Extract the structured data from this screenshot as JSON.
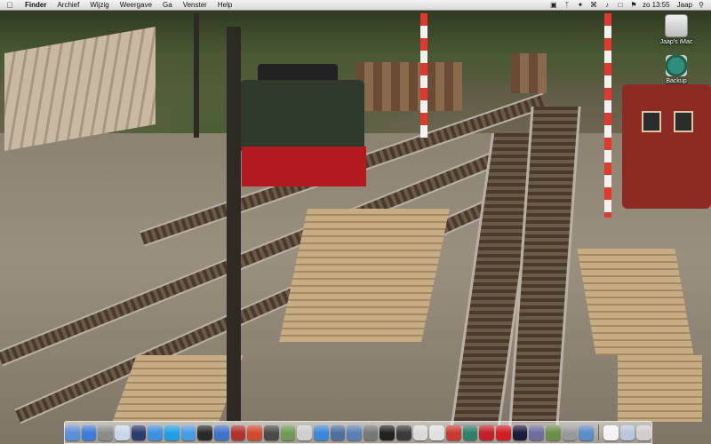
{
  "menubar": {
    "apple_icon": "apple-icon",
    "app_name": "Finder",
    "menus": [
      "Archief",
      "Wijzig",
      "Weergave",
      "Ga",
      "Venster",
      "Help"
    ],
    "tray_icons": [
      "airplay-icon",
      "bluetooth-icon",
      "twitter-icon",
      "wifi-icon",
      "volume-icon",
      "display-icon",
      "flag-icon"
    ],
    "clock": "zo 13:55",
    "user": "Jaap",
    "spotlight_icon": "spotlight-icon"
  },
  "desktop": {
    "icons": [
      {
        "label": "Jaap's iMac",
        "icon": "hard-drive-icon"
      },
      {
        "label": "Backup",
        "icon": "time-machine-icon"
      }
    ]
  },
  "dock": {
    "apps": [
      {
        "icon": "finder-icon",
        "color": "#5b8fd6"
      },
      {
        "icon": "safari-icon",
        "color": "#3f7bd8"
      },
      {
        "icon": "system-preferences-icon",
        "color": "#8c8c8c"
      },
      {
        "icon": "preview-icon",
        "color": "#c9d9ea"
      },
      {
        "icon": "dashboard-icon",
        "color": "#2b3b6c"
      },
      {
        "icon": "app-store-icon",
        "color": "#3d8fe0"
      },
      {
        "icon": "skype-icon",
        "color": "#1fa0e6"
      },
      {
        "icon": "messages-icon",
        "color": "#4a9be3"
      },
      {
        "icon": "spotify-icon",
        "color": "#2a2a2a"
      },
      {
        "icon": "itunes-icon",
        "color": "#3b74c9"
      },
      {
        "icon": "photo-booth-icon",
        "color": "#b0322c"
      },
      {
        "icon": "photo-icon",
        "color": "#d04a2f"
      },
      {
        "icon": "imovie-icon",
        "color": "#4a4a4a"
      },
      {
        "icon": "iphoto-icon",
        "color": "#6f9a56"
      },
      {
        "icon": "screenshot-icon",
        "color": "#cfcfcf"
      },
      {
        "icon": "iweb-icon",
        "color": "#3c87d8"
      },
      {
        "icon": "drive-icon",
        "color": "#4f6f9e"
      },
      {
        "icon": "network-icon",
        "color": "#5a80b2"
      },
      {
        "icon": "utility-icon",
        "color": "#777777"
      },
      {
        "icon": "terminal-icon",
        "color": "#222222"
      },
      {
        "icon": "activity-icon",
        "color": "#3a3a3a"
      },
      {
        "icon": "script-icon",
        "color": "#d9d9d9"
      },
      {
        "icon": "editor-icon",
        "color": "#e0e0e0"
      },
      {
        "icon": "cut-icon",
        "color": "#c83a2f"
      },
      {
        "icon": "time-machine-icon",
        "color": "#2f7f6f"
      },
      {
        "icon": "lastfm-icon",
        "color": "#c21f2a"
      },
      {
        "icon": "sandisk-icon",
        "color": "#d21d23"
      },
      {
        "icon": "space-icon",
        "color": "#1b1b3a"
      },
      {
        "icon": "wallpaper-icon",
        "color": "#6d6d9c"
      },
      {
        "icon": "landscape-icon",
        "color": "#6a8f4a"
      },
      {
        "icon": "stack-icon",
        "color": "#999999"
      },
      {
        "icon": "downloads-icon",
        "color": "#5c8cc8"
      }
    ],
    "trailing": [
      {
        "icon": "documents-stack-icon",
        "color": "#f2f2f2"
      },
      {
        "icon": "folder-stack-icon",
        "color": "#b8c8dc"
      },
      {
        "icon": "trash-icon",
        "color": "#cfcfcf"
      }
    ]
  }
}
